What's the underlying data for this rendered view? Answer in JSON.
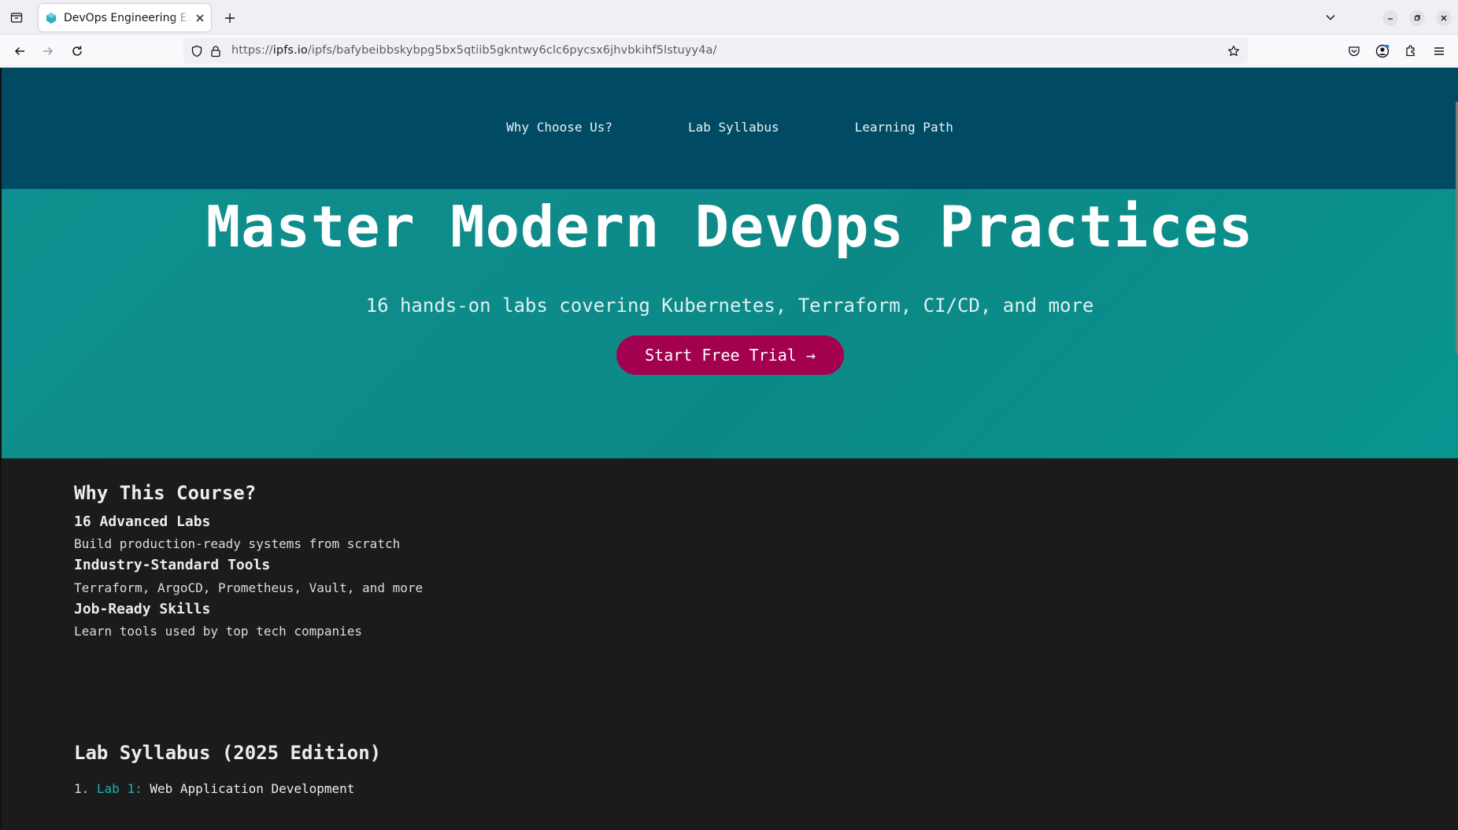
{
  "browser": {
    "tab": {
      "title": "DevOps Engineering Expert Program",
      "favicon": "hexagon-icon",
      "close": "close-icon"
    },
    "url": {
      "prefix": "https://",
      "host": "ipfs.io",
      "path": "/ipfs/bafybeibbskybpg5bx5qtiib5gkntwy6clc6pycsx6jhvbkihf5lstuyy4a/"
    },
    "colors": {
      "tabbar": "#f0f0f4",
      "urlbar": "#f0f0f4"
    }
  },
  "site": {
    "nav": [
      {
        "label": "Why Choose Us?"
      },
      {
        "label": "Lab Syllabus"
      },
      {
        "label": "Learning Path"
      }
    ],
    "hero": {
      "title": "Master Modern DevOps Practices",
      "subtitle": "16 hands-on labs covering Kubernetes, Terraform, CI/CD, and more",
      "cta": "Start Free Trial →"
    },
    "why": {
      "title": "Why This Course?",
      "features": [
        {
          "title": "16 Advanced Labs",
          "desc": "Build production-ready systems from scratch"
        },
        {
          "title": "Industry-Standard Tools",
          "desc": "Terraform, ArgoCD, Prometheus, Vault, and more"
        },
        {
          "title": "Job-Ready Skills",
          "desc": "Learn tools used by top tech companies"
        }
      ]
    },
    "syllabus": {
      "title": "Lab Syllabus (2025 Edition)",
      "items": [
        {
          "num": "1.",
          "lab": "Lab 1:",
          "name": "Web Application Development"
        }
      ]
    },
    "colors": {
      "nav_bg": "#004b63",
      "hero_bg": "#0c8987",
      "cta_bg": "#a3004f",
      "body_bg": "#1c1b1b",
      "lab_accent": "#1bb3b0"
    }
  }
}
